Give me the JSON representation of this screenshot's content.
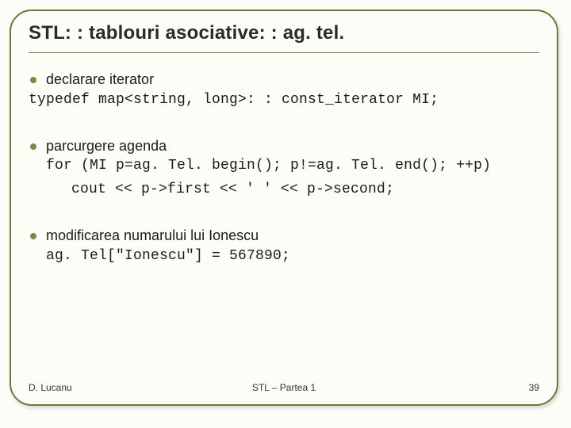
{
  "header": {
    "title": "STL: : tablouri asociative: : ag. tel."
  },
  "bullets": {
    "b1": {
      "lead": "declarare iterator",
      "code": "typedef map<string, long>: : const_iterator MI;"
    },
    "b2": {
      "lead": "parcurgere agenda",
      "code_for": "for (MI p=ag. Tel. begin(); p!=ag. Tel. end(); ++p)",
      "code_cout": "cout << p->first << ' ' << p->second;"
    },
    "b3": {
      "lead": "modificarea numarului lui Ionescu",
      "code": "ag. Tel[\"Ionescu\"] = 567890;"
    }
  },
  "footer": {
    "author": "D. Lucanu",
    "center": "STL – Partea 1",
    "page": "39"
  }
}
